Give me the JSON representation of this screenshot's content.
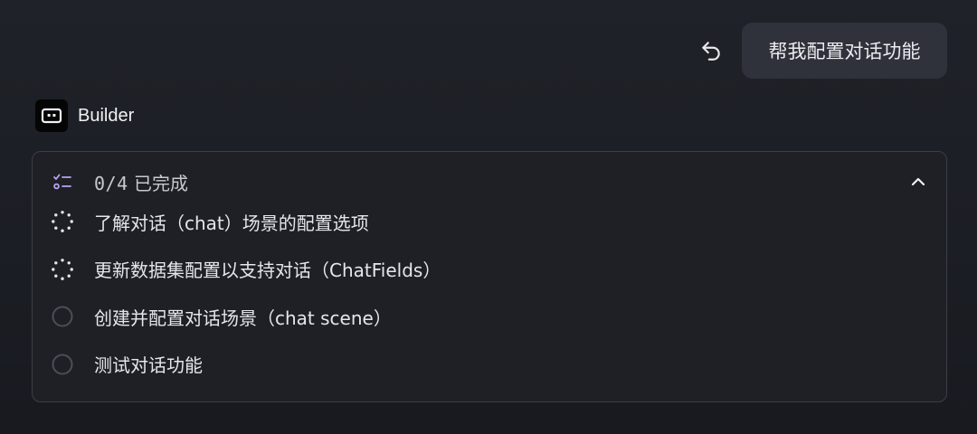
{
  "user_message": {
    "text": "帮我配置对话功能",
    "undo_icon": "undo-icon"
  },
  "agent": {
    "name": "Builder",
    "avatar_icon": "robot-face-icon"
  },
  "task_card": {
    "progress": {
      "completed": 0,
      "total": 4,
      "count_text": "0/4",
      "status_text": "已完成",
      "icon": "checklist-icon"
    },
    "collapse_icon": "chevron-up-icon",
    "tasks": [
      {
        "label": "了解对话（chat）场景的配置选项",
        "status": "in-progress",
        "icon": "spinner-icon"
      },
      {
        "label": "更新数据集配置以支持对话（ChatFields）",
        "status": "in-progress",
        "icon": "spinner-icon"
      },
      {
        "label": "创建并配置对话场景（chat scene）",
        "status": "pending",
        "icon": "empty-circle-icon"
      },
      {
        "label": "测试对话功能",
        "status": "pending",
        "icon": "empty-circle-icon"
      }
    ]
  },
  "colors": {
    "background": "#1c1f25",
    "bubble": "#30323b",
    "card_border": "#3b3e47",
    "checklist_accent": "#b9a4f2",
    "text_primary": "#e6e6ea"
  }
}
